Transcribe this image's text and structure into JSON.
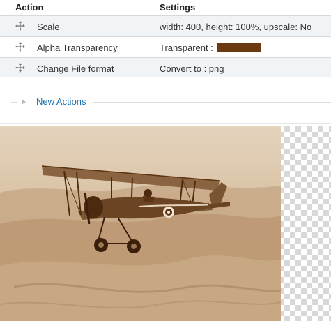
{
  "table": {
    "headers": {
      "action": "Action",
      "settings": "Settings"
    },
    "rows": [
      {
        "name": "Scale",
        "setting": "width: 400, height: 100%, upscale: No"
      },
      {
        "name": "Alpha Transparency",
        "setting": "Transparent :",
        "swatch_color": "#6b3a10"
      },
      {
        "name": "Change File format",
        "setting": "Convert to : png"
      }
    ]
  },
  "new_actions": {
    "label": "New Actions"
  },
  "preview": {
    "tone": "sepia",
    "colors": {
      "sepia_light": "#e9dccb",
      "sepia_mid": "#b28a63",
      "sepia_dark": "#5a3414"
    }
  }
}
